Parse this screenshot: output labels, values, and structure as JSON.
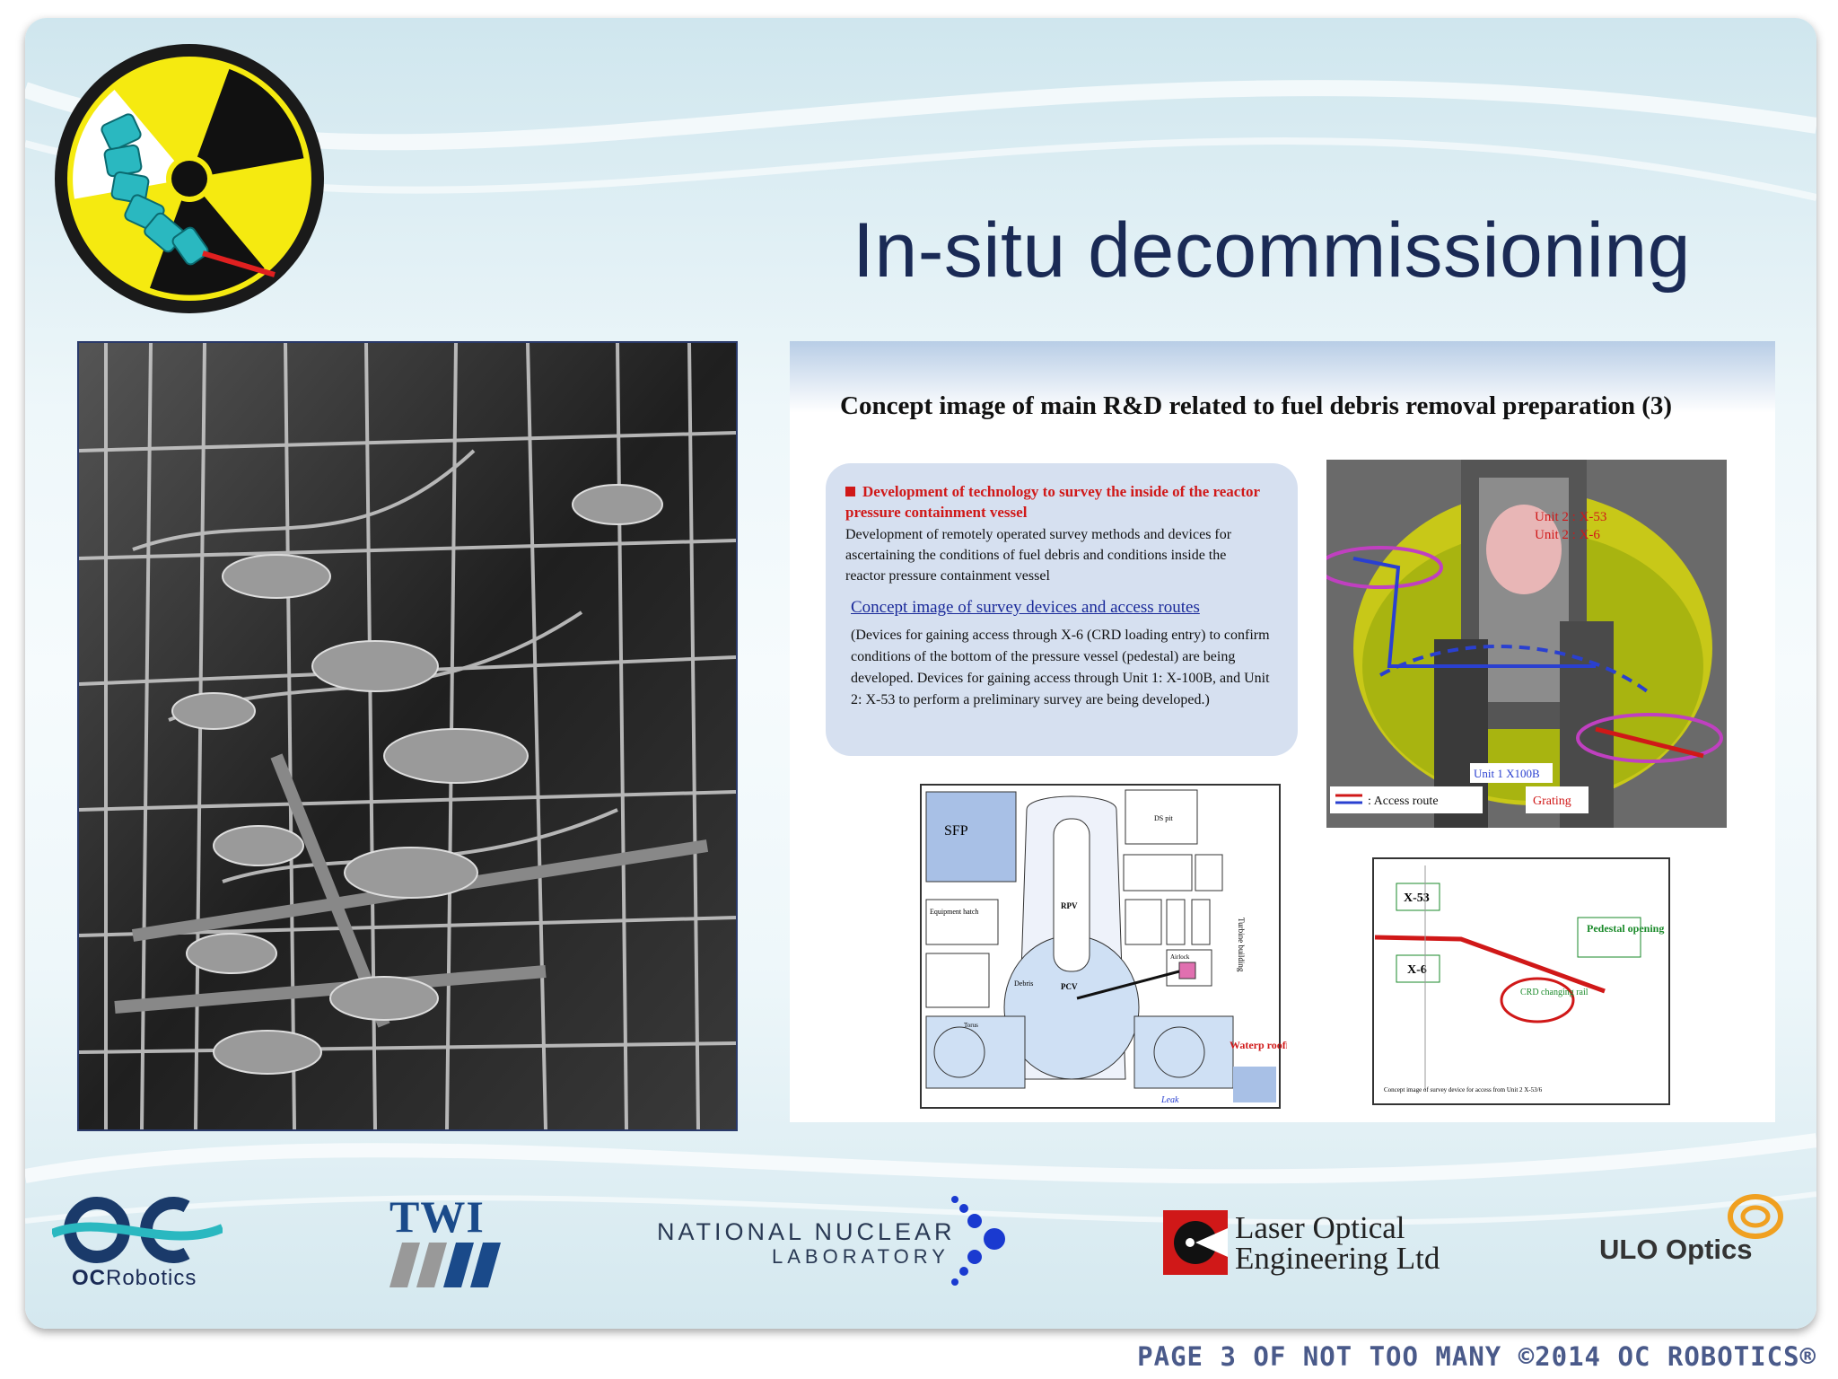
{
  "slide": {
    "title": "In-situ decommissioning"
  },
  "panel": {
    "title": "Concept image of main R&D related to fuel debris removal preparation (3)",
    "info_heading": "Development of technology to survey the inside of the reactor pressure containment vessel",
    "info_body": "Development of remotely operated survey methods and devices for ascertaining the conditions of fuel debris and conditions inside the reactor pressure containment vessel",
    "info_link": "Concept image of survey devices and access routes",
    "info_detail": "(Devices for gaining access through X-6 (CRD loading entry) to confirm conditions of the bottom of the pressure vessel (pedestal) are being developed. Devices for gaining access through Unit 1: X-100B, and Unit 2: X-53 to perform a preliminary survey are being developed.)",
    "diagram_labels": {
      "unit2_x53": "Unit 2 : X-53",
      "unit2_x6": "Unit 2 : X-6",
      "unit1_x100b": "Unit 1   X100B",
      "access_route": ": Access route",
      "grating": "Grating"
    },
    "plan_labels": {
      "sfp": "SFP",
      "ds_pit": "DS pit",
      "equipment_hatch": "Equipment hatch",
      "rpv": "RPV",
      "pcv": "PCV",
      "debris": "Debris",
      "airlock": "Airlock",
      "torus": "Torus",
      "turbine_building": "Turbine building",
      "waterproofing": "Waterp\nroofing",
      "leak": "Leak"
    },
    "rail_labels": {
      "x53": "X-53",
      "x6": "X-6",
      "pedestal_opening": "Pedestal\nopening",
      "crd_rail": "CRD\nchanging\nrail",
      "caption": "Concept image of survey device for access from Unit 2 X-53/6"
    }
  },
  "footer": {
    "oc_prefix": "OC",
    "oc_suffix": "Robotics",
    "twi": "TWI",
    "nnl_line1": "NATIONAL NUCLEAR",
    "nnl_line2": "LABORATORY",
    "loe_line1": "Laser Optical",
    "loe_line2": "Engineering Ltd",
    "ulo": "ULO Optics",
    "page_note": "PAGE 3 OF NOT TOO MANY ©2014 OC ROBOTICS®"
  },
  "colors": {
    "title": "#1a2a55",
    "radiation_yellow": "#f5ea10",
    "snake_cyan": "#2ab8c0",
    "alert_red": "#d01818"
  },
  "icons": [
    "radiation-robot-icon",
    "oc-robotics-logo",
    "twi-logo",
    "nnl-logo",
    "loe-logo",
    "ulo-logo"
  ]
}
